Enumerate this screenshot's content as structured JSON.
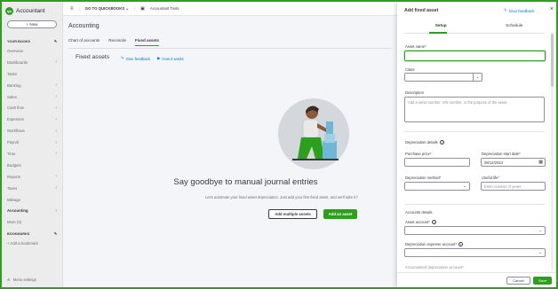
{
  "app": {
    "logo_text": "qb",
    "title": "Accountant",
    "new_button": "+ New"
  },
  "sidebar": {
    "your_books_label": "YOUR BOOKS",
    "items": [
      {
        "label": "Overview",
        "chevron": false
      },
      {
        "label": "Dashboards",
        "chevron": true
      },
      {
        "label": "Tasks",
        "chevron": false
      },
      {
        "label": "Banking",
        "chevron": true
      },
      {
        "label": "Sales",
        "chevron": true
      },
      {
        "label": "Cash flow",
        "chevron": true
      },
      {
        "label": "Expenses",
        "chevron": true
      },
      {
        "label": "Workflows",
        "chevron": true
      },
      {
        "label": "Payroll",
        "chevron": true
      },
      {
        "label": "Time",
        "chevron": true
      },
      {
        "label": "Budgets",
        "chevron": false
      },
      {
        "label": "Reports",
        "chevron": true
      },
      {
        "label": "Taxes",
        "chevron": true
      },
      {
        "label": "Mileage",
        "chevron": false
      },
      {
        "label": "Accounting",
        "chevron": true,
        "active": true
      },
      {
        "label": "More (0)",
        "chevron": false
      }
    ],
    "bookmarks_label": "BOOKMARKS",
    "add_bookmark": "+ Add a bookmark",
    "menu_settings": "Menu settings"
  },
  "topbar": {
    "menu_icon": "≡",
    "go_to": "GO TO QUICKBOOKS",
    "accountant_tools": "Accountant Tools"
  },
  "main": {
    "page_title": "Accounting",
    "tabs": [
      {
        "label": "Chart of accounts"
      },
      {
        "label": "Reconcile"
      },
      {
        "label": "Fixed assets",
        "active": true
      }
    ],
    "section_title": "Fixed assets",
    "give_feedback": "Give feedback",
    "how_it_works": "How it works",
    "headline": "Say goodbye to manual journal entries",
    "subline": "Let's automate your fixed asset depreciation. Just add your first fixed asset, and we'll take it f",
    "add_multiple": "Add multiple assets",
    "add_asset": "Add an asset"
  },
  "drawer": {
    "title": "Add fixed asset",
    "give_feedback": "Give feedback",
    "close": "×",
    "tabs": [
      {
        "label": "Setup",
        "active": true
      },
      {
        "label": "Schedule"
      }
    ],
    "asset_name_label": "Asset name*",
    "asset_name_value": "",
    "class_label": "Class",
    "description_label": "Description",
    "description_placeholder": "Add a serial number, VIN number, or the purpose of the asset.",
    "depreciation_details": "Depreciation details",
    "purchase_price_label": "Purchase price*",
    "dep_start_label": "Depreciation start date*",
    "dep_start_value": "08/12/2023",
    "dep_method_label": "Depreciation method*",
    "useful_life_label": "Useful life*",
    "useful_life_placeholder": "Enter number of years",
    "accounts_details": "Accounts details",
    "asset_account_label": "Asset account*",
    "dep_expense_label": "Depreciation expense account*",
    "accum_dep_label": "Accumulated depreciation account*",
    "cancel": "Cancel",
    "save": "Save"
  },
  "colors": {
    "brand_green": "#2ca01c",
    "link_blue": "#0077c5"
  }
}
